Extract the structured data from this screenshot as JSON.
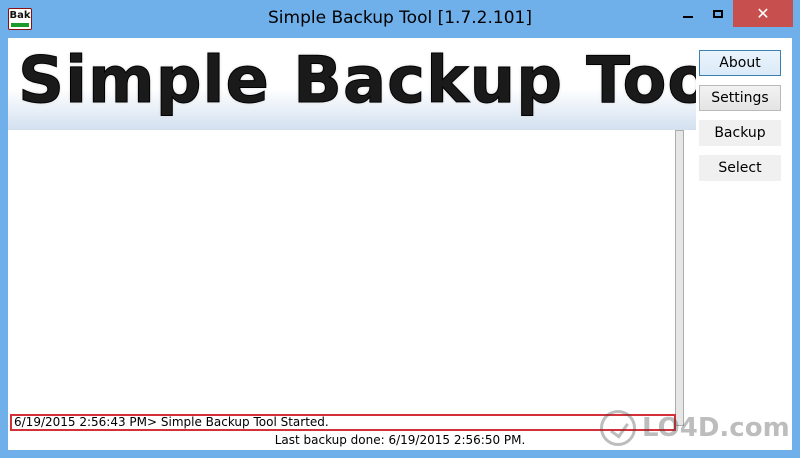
{
  "window": {
    "icon_text": "Bak",
    "title": "Simple Backup Tool [1.7.2.101]",
    "close_glyph": "✕"
  },
  "banner": {
    "text": "Simple Backup Tool"
  },
  "buttons": {
    "about": "About",
    "settings": "Settings",
    "backup": "Backup",
    "select": "Select"
  },
  "log": {
    "lines": [
      "6/19/2015 2:56:43 PM> Simple Backup Tool Started."
    ]
  },
  "status": {
    "text": "Last backup done: 6/19/2015 2:56:50 PM."
  },
  "watermark": {
    "text": "LO4D.com"
  },
  "colors": {
    "titlebar": "#6fb0ea",
    "close_button": "#c7504e",
    "log_highlight_border": "#d4303a"
  }
}
